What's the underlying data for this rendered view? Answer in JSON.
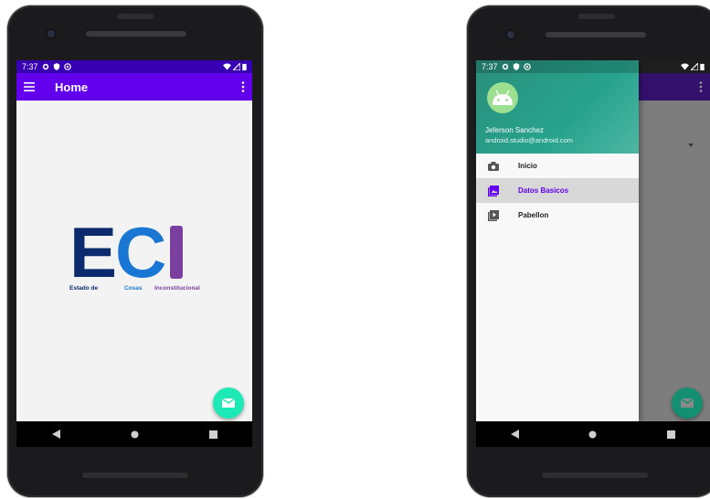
{
  "colors": {
    "primary": "#6200ee",
    "status_bar": "#3700b3",
    "accent_fab": "#1de9b6",
    "logo_e": "#0b2b6e",
    "logo_c": "#1976d2",
    "logo_i": "#7b3fa0",
    "drawer_header": "#24a088"
  },
  "phone_left": {
    "status": {
      "time": "7:37",
      "icons": [
        "settings-icon",
        "shield-icon",
        "at-icon"
      ],
      "right_icons": [
        "wifi-icon",
        "signal-icon",
        "battery-icon"
      ]
    },
    "toolbar": {
      "title": "Home",
      "menu_icon": "hamburger-icon",
      "overflow_icon": "more-vert-icon"
    },
    "logo": {
      "letters": [
        "E",
        "C",
        "I"
      ],
      "subtitle": [
        "Estado de",
        "Cosas",
        "Inconstitucional"
      ]
    },
    "fab_icon": "email-icon",
    "nav": [
      "back-icon",
      "home-icon",
      "recents-icon"
    ]
  },
  "phone_right": {
    "status": {
      "time": "7:37",
      "icons": [
        "settings-icon",
        "shield-icon",
        "at-icon"
      ]
    },
    "drawer": {
      "user_name": "Jeferson Sanchez",
      "user_email": "android.studio@android.com",
      "items": [
        {
          "label": "Inicio",
          "icon": "camera-icon",
          "active": false
        },
        {
          "label": "Datos Basicos",
          "icon": "gallery-icon",
          "active": true
        },
        {
          "label": "Pabellon",
          "icon": "slideshow-icon",
          "active": false
        }
      ]
    },
    "fab_icon": "email-icon",
    "nav": [
      "back-icon",
      "home-icon",
      "recents-icon"
    ]
  }
}
